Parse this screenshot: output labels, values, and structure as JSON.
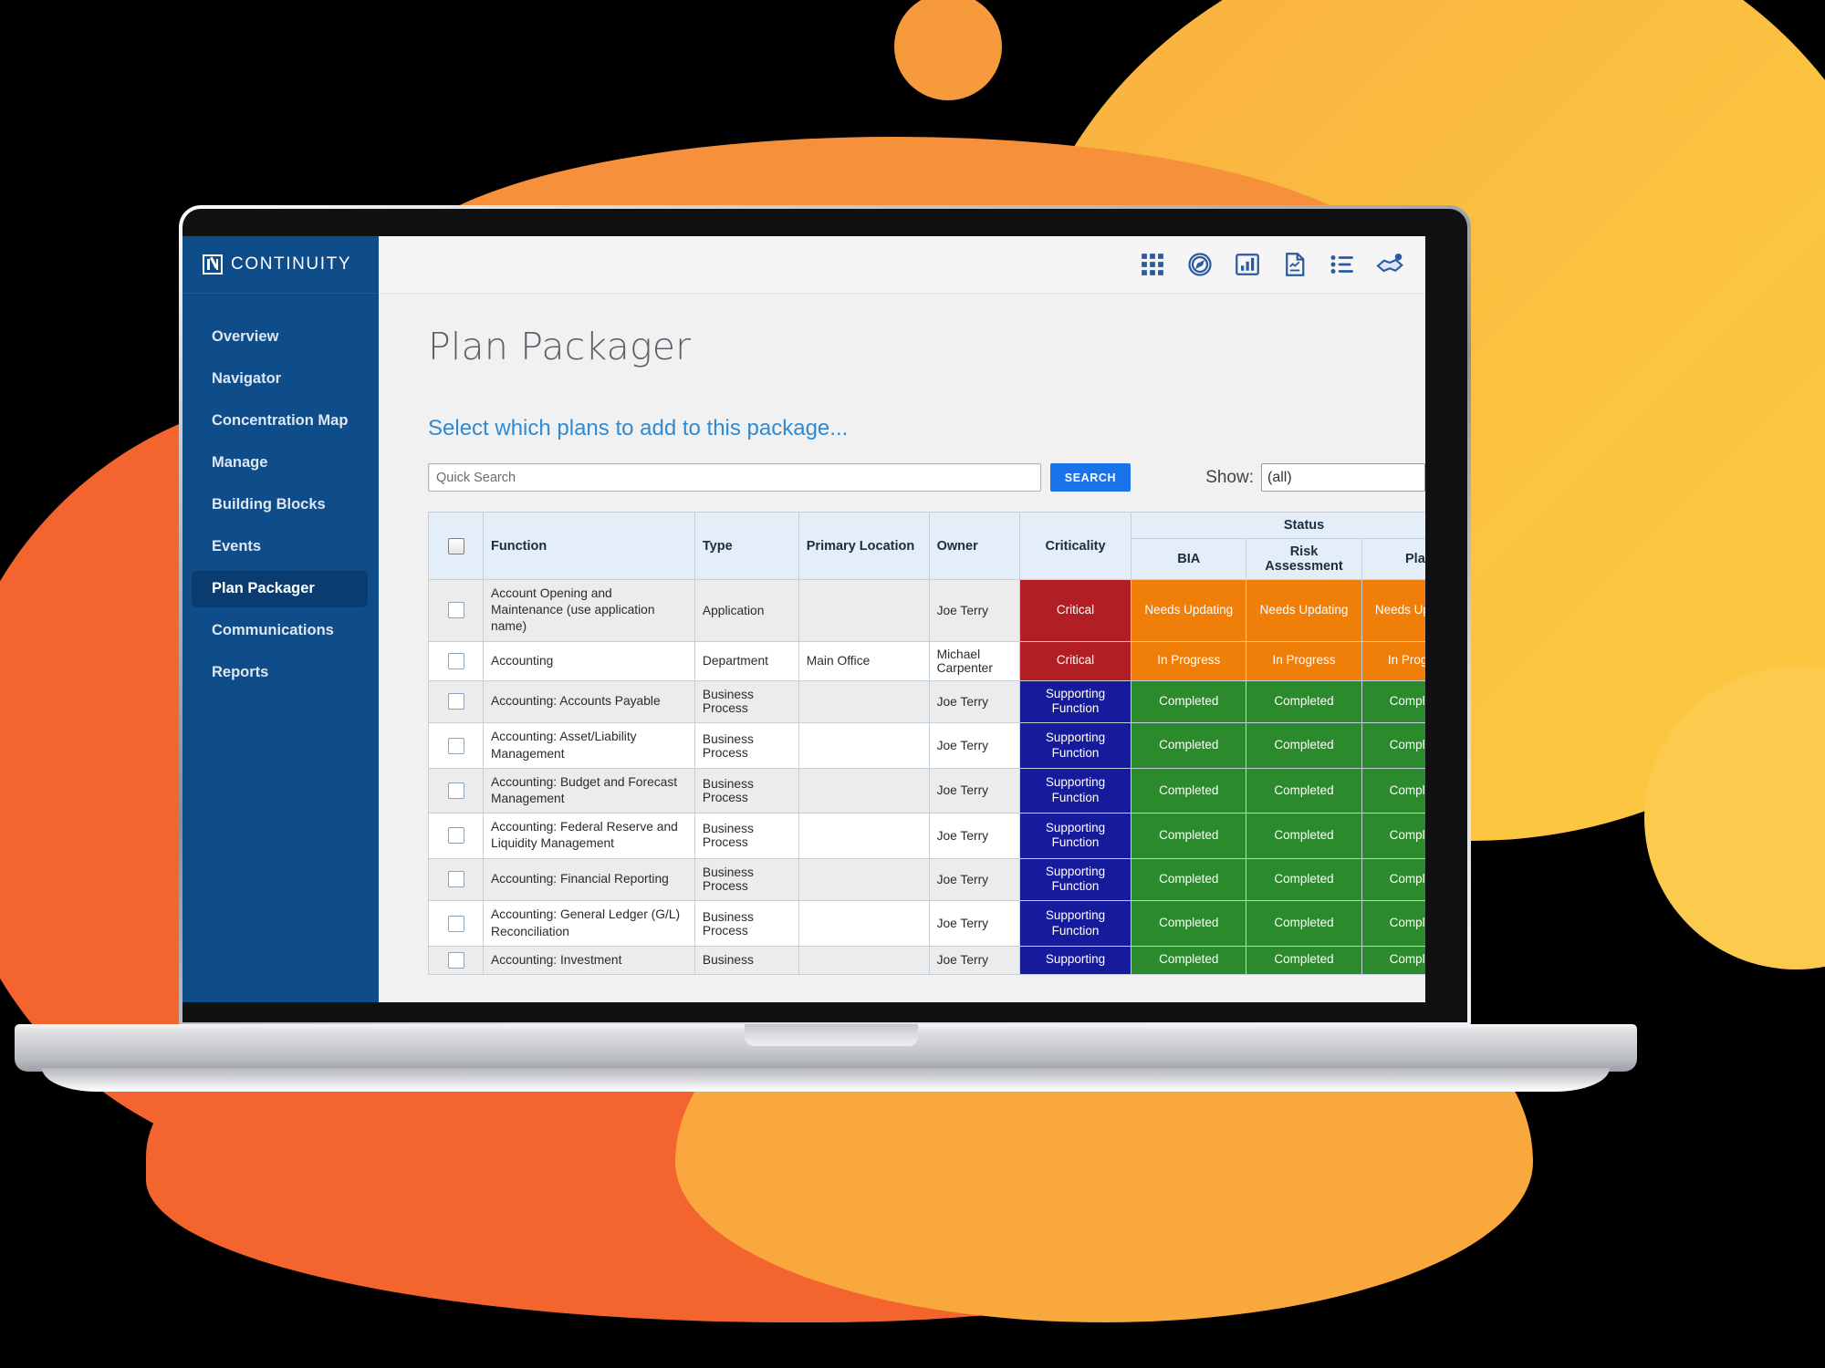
{
  "brand": {
    "name": "CONTINUITY",
    "mark": "n-logo-icon"
  },
  "sidebar": {
    "items": [
      {
        "label": "Overview",
        "active": false
      },
      {
        "label": "Navigator",
        "active": false
      },
      {
        "label": "Concentration Map",
        "active": false
      },
      {
        "label": "Manage",
        "active": false
      },
      {
        "label": "Building Blocks",
        "active": false
      },
      {
        "label": "Events",
        "active": false
      },
      {
        "label": "Plan Packager",
        "active": true
      },
      {
        "label": "Communications",
        "active": false
      },
      {
        "label": "Reports",
        "active": false
      }
    ]
  },
  "topbar": {
    "icons": [
      {
        "name": "apps-grid-icon"
      },
      {
        "name": "compass-navigator-icon"
      },
      {
        "name": "bar-chart-icon"
      },
      {
        "name": "document-report-icon"
      },
      {
        "name": "list-checklist-icon"
      },
      {
        "name": "handshake-icon"
      }
    ]
  },
  "page": {
    "title": "Plan Packager",
    "subtitle": "Select which plans to add to this package..."
  },
  "controls": {
    "search_placeholder": "Quick Search",
    "search_value": "",
    "search_button": "SEARCH",
    "show_label": "Show:",
    "show_value": "(all)",
    "show_options": [
      "(all)"
    ]
  },
  "table": {
    "group_header": "Status",
    "headers": {
      "select": "",
      "function": "Function",
      "type": "Type",
      "primary_location": "Primary Location",
      "owner": "Owner",
      "criticality": "Criticality",
      "bia": "BIA",
      "risk_assessment": "Risk Assessment",
      "plan": "Plan"
    },
    "rows": [
      {
        "function": "Account Opening and Maintenance (use application name)",
        "type": "Application",
        "primary_location": "",
        "owner": "Joe Terry",
        "criticality": "Critical",
        "criticality_color": "#B11F24",
        "bia": "Needs Updating",
        "risk_assessment": "Needs Updating",
        "plan": "Needs Updating",
        "status_color": "#F07F09"
      },
      {
        "function": "Accounting",
        "type": "Department",
        "primary_location": "Main Office",
        "owner": "Michael Carpenter",
        "criticality": "Critical",
        "criticality_color": "#B11F24",
        "bia": "In Progress",
        "risk_assessment": "In Progress",
        "plan": "In Progress",
        "status_color": "#F07F09"
      },
      {
        "function": "Accounting: Accounts Payable",
        "type": "Business Process",
        "primary_location": "",
        "owner": "Joe Terry",
        "criticality": "Supporting Function",
        "criticality_color": "#161B9B",
        "bia": "Completed",
        "risk_assessment": "Completed",
        "plan": "Completed",
        "status_color": "#2B8A2B"
      },
      {
        "function": "Accounting: Asset/Liability Management",
        "type": "Business Process",
        "primary_location": "",
        "owner": "Joe Terry",
        "criticality": "Supporting Function",
        "criticality_color": "#161B9B",
        "bia": "Completed",
        "risk_assessment": "Completed",
        "plan": "Completed",
        "status_color": "#2B8A2B"
      },
      {
        "function": "Accounting: Budget and Forecast Management",
        "type": "Business Process",
        "primary_location": "",
        "owner": "Joe Terry",
        "criticality": "Supporting Function",
        "criticality_color": "#161B9B",
        "bia": "Completed",
        "risk_assessment": "Completed",
        "plan": "Completed",
        "status_color": "#2B8A2B"
      },
      {
        "function": "Accounting: Federal Reserve and Liquidity Management",
        "type": "Business Process",
        "primary_location": "",
        "owner": "Joe Terry",
        "criticality": "Supporting Function",
        "criticality_color": "#161B9B",
        "bia": "Completed",
        "risk_assessment": "Completed",
        "plan": "Completed",
        "status_color": "#2B8A2B"
      },
      {
        "function": "Accounting: Financial Reporting",
        "type": "Business Process",
        "primary_location": "",
        "owner": "Joe Terry",
        "criticality": "Supporting Function",
        "criticality_color": "#161B9B",
        "bia": "Completed",
        "risk_assessment": "Completed",
        "plan": "Completed",
        "status_color": "#2B8A2B"
      },
      {
        "function": "Accounting: General Ledger (G/L) Reconciliation",
        "type": "Business Process",
        "primary_location": "",
        "owner": "Joe Terry",
        "criticality": "Supporting Function",
        "criticality_color": "#161B9B",
        "bia": "Completed",
        "risk_assessment": "Completed",
        "plan": "Completed",
        "status_color": "#2B8A2B"
      },
      {
        "function": "Accounting: Investment",
        "type": "Business",
        "primary_location": "",
        "owner": "Joe Terry",
        "criticality": "Supporting",
        "criticality_color": "#161B9B",
        "bia": "Completed",
        "risk_assessment": "Completed",
        "plan": "Completed",
        "status_color": "#2B8A2B"
      }
    ]
  },
  "theme": {
    "brand_blue": "#0F4C8A",
    "accent_blue": "#1A73E8",
    "link_blue": "#2E8BD4",
    "bg_orange": "#F4642F",
    "bg_amber": "#F9A83D",
    "bg_yellow": "#FCCB4D"
  }
}
